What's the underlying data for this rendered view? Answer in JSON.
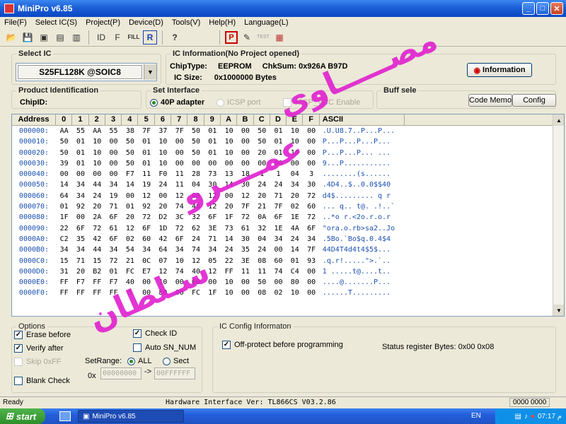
{
  "window": {
    "title": "MiniPro v6.85",
    "buttons": [
      "_",
      "□",
      "✕"
    ]
  },
  "menu": [
    "File(F)",
    "Select IC(S)",
    "Project(P)",
    "Device(D)",
    "Tools(V)",
    "Help(H)",
    "Language(L)"
  ],
  "toolbar": {
    "icons": [
      "open-icon",
      "save-icon",
      "select-ic-icon",
      "project-icon",
      "save-project-icon",
      "device-id-icon",
      "function-icon",
      "fill-icon",
      "read-icon",
      "help-icon",
      "program-icon",
      "edit-icon",
      "test-icon",
      "chip-icon"
    ],
    "labels": {
      "device_id": "ID",
      "fill": "FILL",
      "read": "R",
      "help": "?",
      "program": "P",
      "test": "TEST",
      "function": "F"
    }
  },
  "select_ic": {
    "label": "Select IC",
    "value": "S25FL128K @SOIC8"
  },
  "ic_info": {
    "label": "IC Information(No Project opened)",
    "chip_type_label": "ChipType:",
    "chip_type": "EEPROM",
    "checksum_label": "ChkSum:",
    "checksum": "0x926A B97D",
    "size_label": "IC Size:",
    "size": "0x1000000 Bytes",
    "info_button": "Information"
  },
  "product": {
    "label": "Product Identification",
    "chip_id_label": "ChipID:"
  },
  "interface": {
    "label": "Set Interface",
    "opt1": "40P adapter",
    "opt2": "ICSP port",
    "opt3": "ICSP_VCC Enable"
  },
  "buffer": {
    "label": "Buff sele",
    "code_memo": "Code Memo",
    "config": "Config"
  },
  "hex": {
    "headers": [
      "Address",
      "0",
      "1",
      "2",
      "3",
      "4",
      "5",
      "6",
      "7",
      "8",
      "9",
      "A",
      "B",
      "C",
      "D",
      "E",
      "F",
      "ASCII"
    ],
    "rows": [
      [
        "000000:",
        "AA",
        "55",
        "AA",
        "55",
        "38",
        "7F",
        "37",
        "7F",
        "50",
        "01",
        "10",
        "00",
        "50",
        "01",
        "10",
        "00",
        ".U.U8.7..P...P..."
      ],
      [
        "000010:",
        "50",
        "01",
        "10",
        "00",
        "50",
        "01",
        "10",
        "00",
        "50",
        "01",
        "10",
        "00",
        "50",
        "01",
        "10",
        "00",
        "P...P...P...P..."
      ],
      [
        "000020:",
        "50",
        "01",
        "10",
        "00",
        "50",
        "01",
        "10",
        "00",
        "50",
        "01",
        "10",
        "00",
        "20",
        "01",
        "10",
        "00",
        "P...P...P... ..."
      ],
      [
        "000030:",
        "39",
        "01",
        "10",
        "00",
        "50",
        "01",
        "10",
        "00",
        "00",
        "00",
        "00",
        "00",
        "00",
        "00",
        "00",
        "00",
        "9...P..........."
      ],
      [
        "000040:",
        "00",
        "00",
        "00",
        "00",
        "F7",
        "11",
        "F0",
        "11",
        "28",
        "73",
        "13",
        "18",
        "1",
        "1",
        "04",
        "3",
        "........(s......"
      ],
      [
        "000050:",
        "14",
        "34",
        "44",
        "34",
        "14",
        "19",
        "24",
        "11",
        "04",
        "30",
        "14",
        "30",
        "24",
        "24",
        "34",
        "30",
        ".4D4..$..0.0$$40"
      ],
      [
        "000060:",
        "64",
        "34",
        "24",
        "19",
        "00",
        "12",
        "00",
        "12",
        "00",
        "12",
        "00",
        "12",
        "20",
        "71",
        "20",
        "72",
        "d4$......... q r"
      ],
      [
        "000070:",
        "01",
        "92",
        "20",
        "71",
        "01",
        "92",
        "20",
        "74",
        "40",
        "12",
        "20",
        "7F",
        "21",
        "7F",
        "02",
        "60",
        "... q.. t@. .!..`"
      ],
      [
        "000080:",
        "1F",
        "00",
        "2A",
        "6F",
        "20",
        "72",
        "D2",
        "3C",
        "32",
        "6F",
        "1F",
        "72",
        "0A",
        "6F",
        "1E",
        "72",
        "..*o r.<2o.r.o.r"
      ],
      [
        "000090:",
        "22",
        "6F",
        "72",
        "61",
        "12",
        "6F",
        "1D",
        "72",
        "62",
        "3E",
        "73",
        "61",
        "32",
        "1E",
        "4A",
        "6F",
        "\"ora.o.rb>sa2..Jo"
      ],
      [
        "0000A0:",
        "C2",
        "35",
        "42",
        "6F",
        "02",
        "60",
        "42",
        "6F",
        "24",
        "71",
        "14",
        "30",
        "04",
        "34",
        "24",
        "34",
        ".5Bo.`Bo$q.0.4$4"
      ],
      [
        "0000B0:",
        "34",
        "34",
        "44",
        "34",
        "54",
        "34",
        "64",
        "34",
        "74",
        "34",
        "24",
        "35",
        "24",
        "00",
        "14",
        "7F",
        "44D4T4d4t4$5$..."
      ],
      [
        "0000C0:",
        "15",
        "71",
        "15",
        "72",
        "21",
        "0C",
        "07",
        "10",
        "12",
        "05",
        "22",
        "3E",
        "08",
        "60",
        "01",
        "93",
        ".q.r!.....\">.`.."
      ],
      [
        "0000D0:",
        "31",
        "20",
        "B2",
        "01",
        "FC",
        "E7",
        "12",
        "74",
        "40",
        "12",
        "FF",
        "11",
        "11",
        "74",
        "C4",
        "00",
        "1 .....t@....t.."
      ],
      [
        "0000E0:",
        "FF",
        "F7",
        "FF",
        "F7",
        "40",
        "00",
        "10",
        "00",
        "00",
        "00",
        "10",
        "00",
        "50",
        "00",
        "80",
        "00",
        "....@.......P..."
      ],
      [
        "0000F0:",
        "FF",
        "FF",
        "FF",
        "FF",
        "5",
        "00",
        "80",
        "00",
        "FC",
        "1F",
        "10",
        "00",
        "08",
        "02",
        "10",
        "00",
        "......T........."
      ]
    ]
  },
  "options": {
    "label": "Options",
    "erase": "Erase before",
    "verify": "Verify after",
    "skip": "Skip 0xFF",
    "blank": "Blank Check",
    "check_id": "Check ID",
    "auto_sn": "Auto SN_NUM",
    "setrange": "SetRange:",
    "all": "ALL",
    "sect": "Sect",
    "ox": "0x",
    "range_start": "00000000",
    "arrow": "->",
    "range_end": "00FFFFFF"
  },
  "ic_config": {
    "label": "IC Config Informaton",
    "off_protect": "Off-protect before programming",
    "status": "Status register Bytes: 0x00 0x08"
  },
  "status": {
    "ready": "Ready",
    "hw": "Hardware Interface Ver: TL866CS V03.2.86",
    "count": "0000 0000"
  },
  "taskbar": {
    "start": "start",
    "task": "MiniPro v6.85",
    "lang": "EN",
    "time": "07:17 م"
  },
  "overlay": {
    "line1": "مصـــــاوی",
    "line2": "عمــــرو",
    "line3": "سـلطان"
  }
}
